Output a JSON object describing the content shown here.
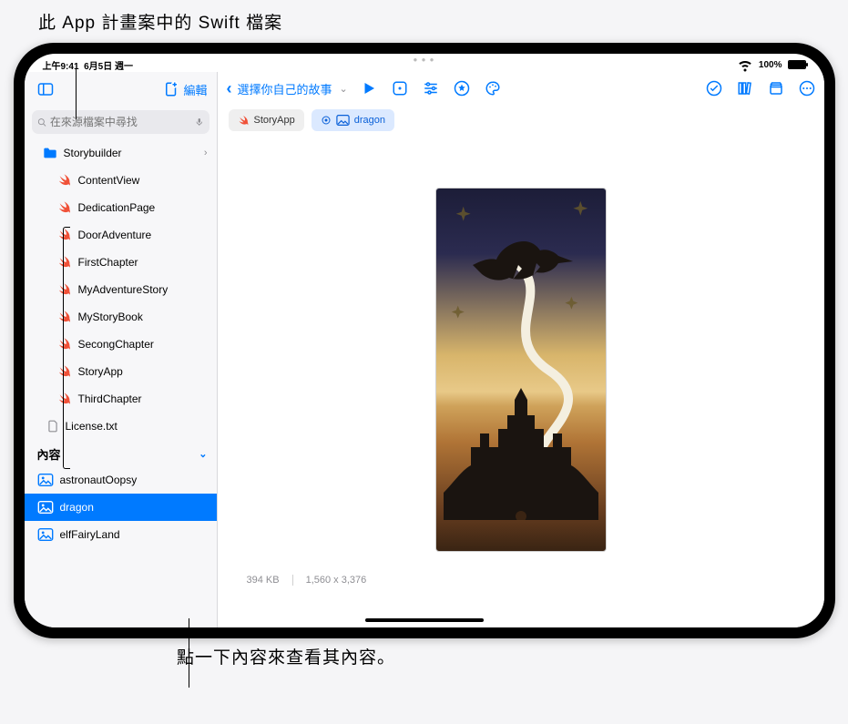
{
  "callouts": {
    "top": "此 App 計畫案中的 Swift 檔案",
    "bottom": "點一下內容來查看其內容。"
  },
  "status": {
    "time": "上午9:41",
    "date": "6月5日 週一",
    "battery_pct": "100%"
  },
  "sidebar": {
    "edit_label": "編輯",
    "search_placeholder": "在來源檔案中尋找",
    "folder": {
      "name": "Storybuilder"
    },
    "swift_files": [
      "ContentView",
      "DedicationPage",
      "DoorAdventure",
      "FirstChapter",
      "MyAdventureStory",
      "MyStoryBook",
      "SecongChapter",
      "StoryApp",
      "ThirdChapter"
    ],
    "other_files": [
      "License.txt"
    ],
    "content_header": "內容",
    "assets": [
      {
        "name": "astronautOopsy",
        "selected": false
      },
      {
        "name": "dragon",
        "selected": true
      },
      {
        "name": "elfFairyLand",
        "selected": false
      }
    ]
  },
  "toolbar": {
    "back_label": "選擇你自己的故事"
  },
  "breadcrumb": {
    "root": "StoryApp",
    "current": "dragon"
  },
  "preview": {
    "filesize": "394 KB",
    "dimensions": "1,560 x 3,376"
  },
  "icons": {
    "sidebar_toggle": "sidebar-icon",
    "new_file": "new-file-icon",
    "mic": "mic-icon",
    "search": "search-icon",
    "folder": "folder-icon",
    "swift": "swift-icon",
    "txt": "file-icon",
    "image": "image-icon",
    "play": "play-icon",
    "rect": "app-preview-icon",
    "sliders": "sliders-icon",
    "star": "star-circle-icon",
    "palette": "palette-icon",
    "check": "check-circle-icon",
    "library": "library-icon",
    "box": "box-icon",
    "more": "more-circle-icon"
  }
}
